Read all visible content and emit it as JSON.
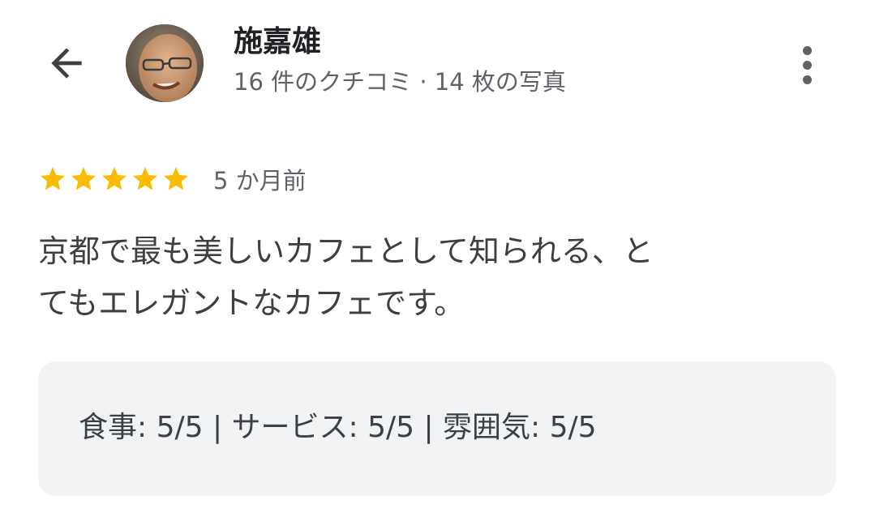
{
  "header": {
    "back_icon": "arrow-back-icon",
    "avatar_icon": "user-avatar",
    "user_name": "施嘉雄",
    "user_stats": "16 件のクチコミ · 14 枚の写真",
    "more_icon": "more-vert-icon"
  },
  "review": {
    "star_rating": 5,
    "star_max": 5,
    "star_color": "#fbbc04",
    "date": "5 か月前",
    "text_line1": "京都で最も美しいカフェとして知られる、と",
    "text_line2": "てもエレガントなカフェです。"
  },
  "aspect_ratings": {
    "text": "食事: 5/5  |  サービス: 5/5  |  雰囲気: 5/5"
  }
}
